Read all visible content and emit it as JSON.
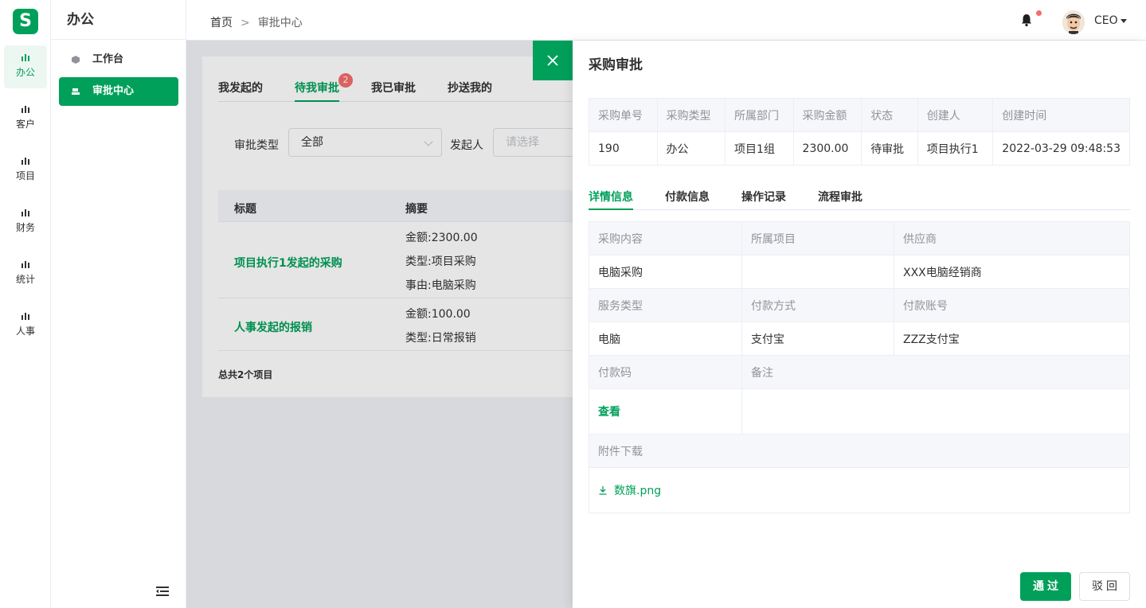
{
  "rail": {
    "logo": "S",
    "items": [
      {
        "label": "办公"
      },
      {
        "label": "客户"
      },
      {
        "label": "项目"
      },
      {
        "label": "财务"
      },
      {
        "label": "统计"
      },
      {
        "label": "人事"
      }
    ],
    "accent": "#00a05a"
  },
  "sidebar": {
    "title": "办公",
    "items": [
      {
        "label": "工作台",
        "icon": "cube-icon"
      },
      {
        "label": "审批中心",
        "icon": "stamp-icon"
      }
    ]
  },
  "header": {
    "breadcrumb": [
      "首页",
      ">",
      "审批中心"
    ],
    "user": "CEO"
  },
  "main": {
    "tabs": [
      {
        "label": "我发起的"
      },
      {
        "label": "待我审批",
        "badge": "2"
      },
      {
        "label": "我已审批"
      },
      {
        "label": "抄送我的"
      }
    ],
    "filters": {
      "type_label": "审批类型",
      "type_value": "全部",
      "initiator_label": "发起人",
      "initiator_placeholder": "请选择"
    },
    "table": {
      "headers": [
        "标题",
        "摘要"
      ],
      "rows": [
        {
          "title": "项目执行1发起的采购",
          "summary": [
            "金额:2300.00",
            "类型:项目采购",
            "事由:电脑采购"
          ]
        },
        {
          "title": "人事发起的报销",
          "summary": [
            "金额:100.00",
            "类型:日常报销"
          ]
        }
      ]
    },
    "total": "总共2个项目"
  },
  "drawer": {
    "title": "采购审批",
    "summary_headers": [
      "采购单号",
      "采购类型",
      "所属部门",
      "采购金额",
      "状态",
      "创建人",
      "创建时间"
    ],
    "summary_values": [
      "190",
      "办公",
      "项目1组",
      "2300.00",
      "待审批",
      "项目执行1",
      "2022-03-29 09:48:53"
    ],
    "tabs": [
      "详情信息",
      "付款信息",
      "操作记录",
      "流程审批"
    ],
    "details": {
      "row1_labels": [
        "采购内容",
        "所属项目",
        "供应商"
      ],
      "row1_values": [
        "电脑采购",
        "",
        "XXX电脑经销商"
      ],
      "row2_labels": [
        "服务类型",
        "付款方式",
        "付款账号"
      ],
      "row2_values": [
        "电脑",
        "支付宝",
        "ZZZ支付宝"
      ],
      "row3_labels": [
        "付款码",
        "备注"
      ],
      "payment_code_link": "查看",
      "attachment_label": "附件下载",
      "attachment_file": "数旗.png"
    },
    "approve_button": "通过",
    "reject_button": "驳回"
  }
}
